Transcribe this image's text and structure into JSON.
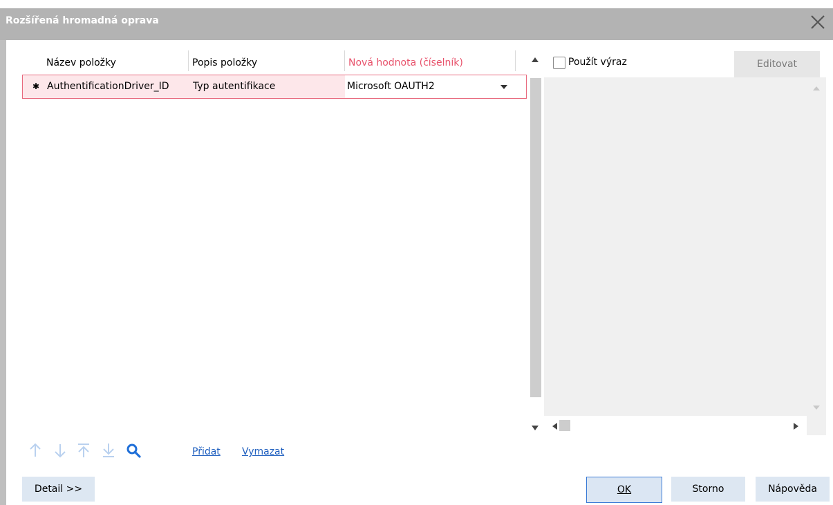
{
  "window": {
    "title": "Rozšířená hromadná oprava"
  },
  "grid": {
    "columns": [
      {
        "label": "Název položky"
      },
      {
        "label": "Popis položky"
      },
      {
        "label": "Nová hodnota (číselník)"
      }
    ],
    "rows": [
      {
        "marker": "✱",
        "name": "AuthentificationDriver_ID",
        "description": "Typ autentifikace",
        "value": "Microsoft OAUTH2"
      }
    ]
  },
  "expression": {
    "checkbox_label": "Použít výraz",
    "checked": false,
    "edit_label": "Editovat"
  },
  "toolbar": {
    "add_label": "Přidat",
    "delete_label": "Vymazat"
  },
  "footer": {
    "detail_label": "Detail >>",
    "ok_label": "OK",
    "cancel_label": "Storno",
    "help_label": "Nápověda"
  },
  "colors": {
    "accent_red": "#e8526b",
    "title_bg": "#b3b3b3",
    "link": "#1f5fbf"
  },
  "icons": [
    "close-icon",
    "arrow-up-icon",
    "arrow-down-icon",
    "move-top-icon",
    "move-bottom-icon",
    "search-icon",
    "dropdown-arrow-icon"
  ]
}
